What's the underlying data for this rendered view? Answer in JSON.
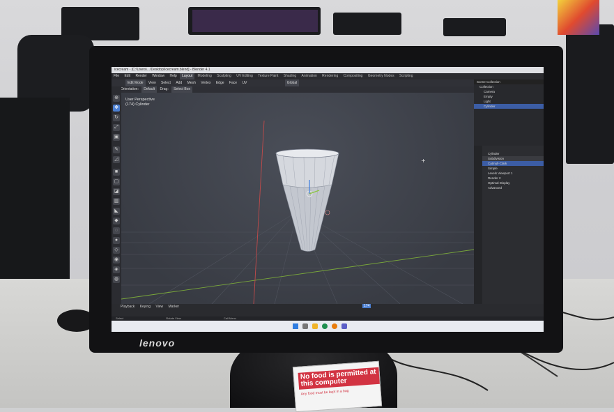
{
  "background": {
    "monitor_brand": "Lenovo",
    "wall_color": "#d6d6d8"
  },
  "monitor": {
    "brand_logo": "lenovo",
    "bezel_color": "#121214"
  },
  "blender": {
    "title_bar": "icecream - [C:\\Users\\...\\Desktop\\icecream.blend] - Blender 4.1",
    "menus": [
      "File",
      "Edit",
      "Render",
      "Window",
      "Help"
    ],
    "workspace_tabs": [
      "Layout",
      "Modeling",
      "Sculpting",
      "UV Editing",
      "Texture Paint",
      "Shading",
      "Animation",
      "Rendering",
      "Compositing",
      "Geometry Nodes",
      "Scripting"
    ],
    "active_tab": "Layout",
    "header": {
      "mode": "Edit Mode",
      "menu_items": [
        "View",
        "Select",
        "Add",
        "Mesh",
        "Vertex",
        "Edge",
        "Face",
        "UV"
      ],
      "transform": "Global"
    },
    "subheader": {
      "orientation_label": "Orientation:",
      "orientation_value": "Default",
      "drag_label": "Drag:",
      "drag_value": "Select Box"
    },
    "viewport": {
      "view_name": "User Perspective",
      "object_label": "(174) Cylinder"
    },
    "outliner": {
      "title": "Scene Collection",
      "rows": [
        "Collection",
        "Camera",
        "Empty",
        "Light",
        "Cylinder"
      ],
      "selected": "Cylinder"
    },
    "properties": {
      "object_name": "Cylinder",
      "modifier_name": "Subdivision",
      "rows": [
        "Catmull-Clark",
        "Simple",
        "Levels Viewport",
        "Render",
        "Optimal Display",
        "Advanced"
      ],
      "levels_viewport": "1",
      "render_levels": "2"
    },
    "timeline": {
      "menus": [
        "Playback",
        "Keying",
        "View",
        "Marker"
      ],
      "frame": "174"
    },
    "statusbar": {
      "left": "Select",
      "middle": "Rotate View",
      "right": "Call Menu"
    }
  },
  "sticker": {
    "headline": "No food is permitted at this computer",
    "subtext": "Any food must be kept in a bag"
  },
  "colors": {
    "viewport_bg": "#3c3f47",
    "selection_blue": "#3c5da5",
    "accent_blue": "#4b7fd1",
    "sticker_red": "#d23342"
  }
}
